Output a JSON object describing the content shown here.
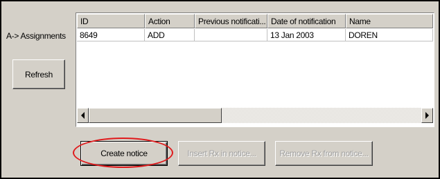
{
  "left_panel": {
    "label": "A-> Assignments",
    "refresh_label": "Refresh"
  },
  "grid": {
    "columns": [
      "ID",
      "Action",
      "Previous notificati...",
      "Date of notification",
      "Name"
    ],
    "rows": [
      [
        "8649",
        "ADD",
        "",
        "13 Jan 2003",
        "DOREN"
      ]
    ]
  },
  "buttons": {
    "create_notice": "Create notice",
    "insert_rx": "Insert Rx in notice...",
    "remove_rx": "Remove Rx from notice..."
  },
  "icons": {
    "scroll_left": "left-arrow-icon",
    "scroll_right": "right-arrow-icon"
  },
  "colors": {
    "window_bg": "#d4d0c8",
    "highlight": "#e0191b"
  }
}
